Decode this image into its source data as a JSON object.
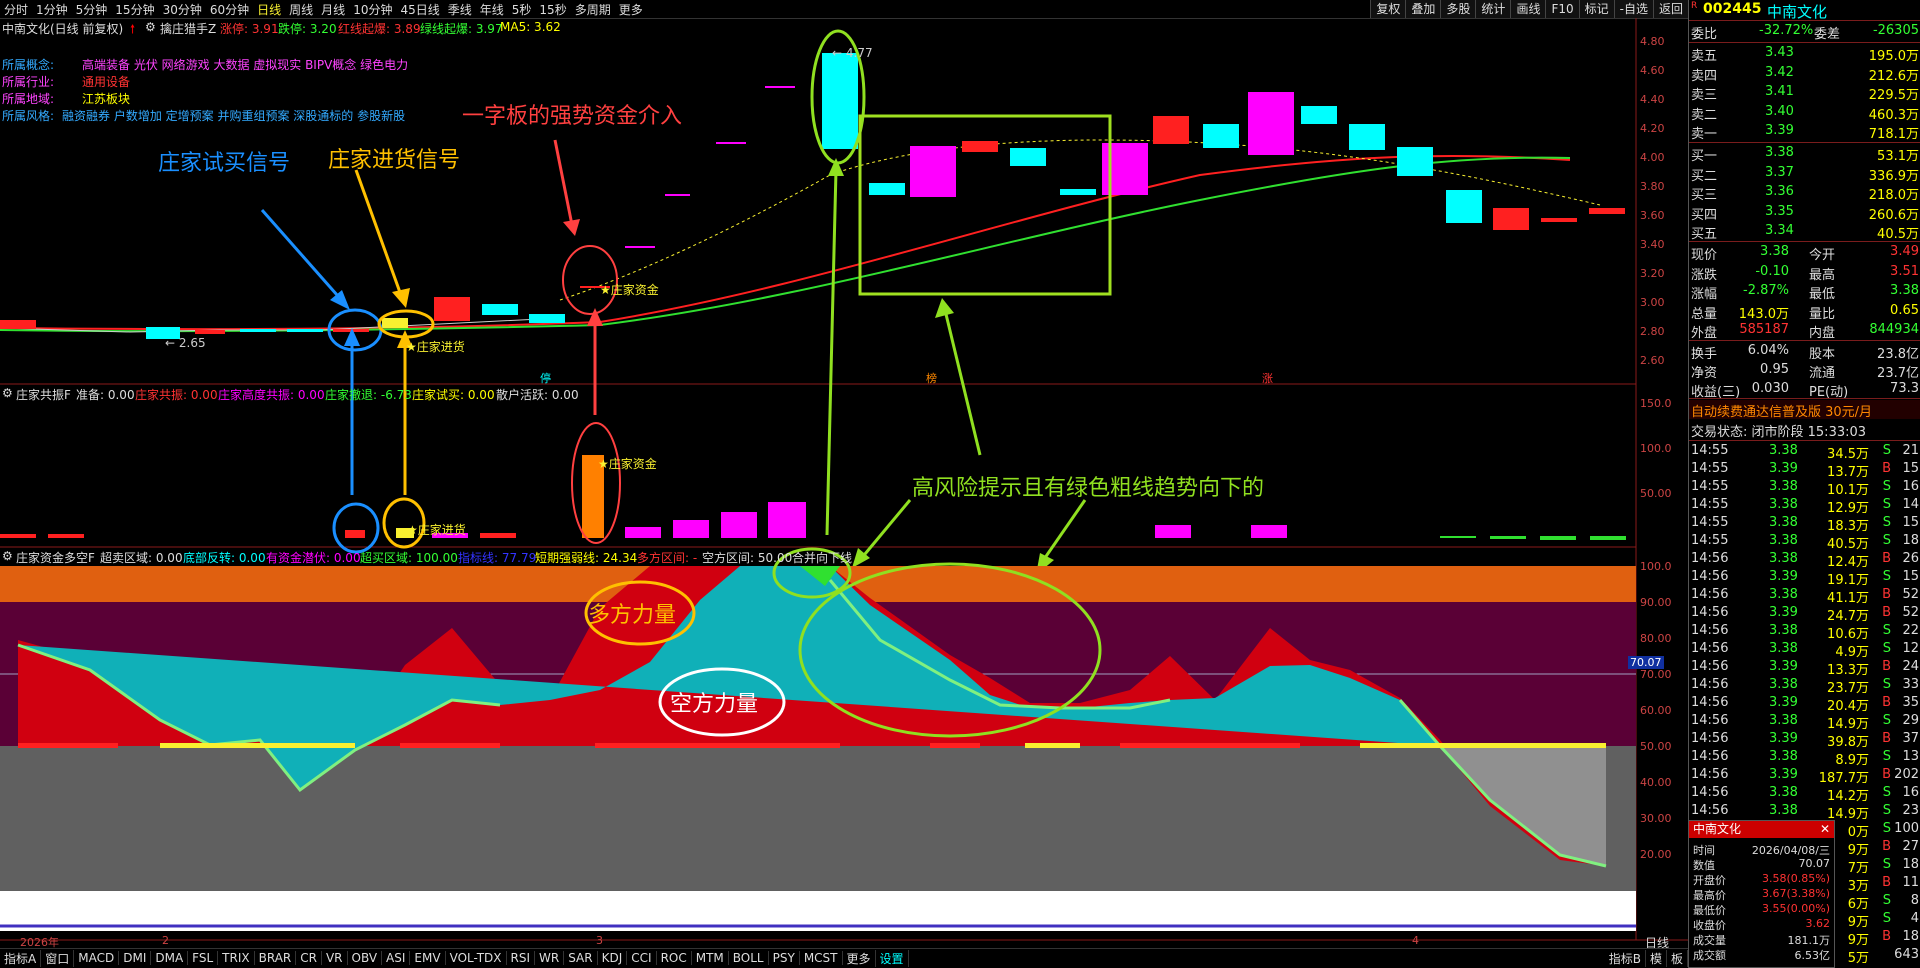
{
  "toolbar": {
    "periods": [
      "分时",
      "1分钟",
      "5分钟",
      "15分钟",
      "30分钟",
      "60分钟",
      "日线",
      "周线",
      "月线",
      "10分钟",
      "45日线",
      "季线",
      "年线",
      "5秒",
      "15秒",
      "多周期",
      "更多"
    ],
    "active": "日线",
    "right_buttons": [
      "复权",
      "叠加",
      "多股",
      "统计",
      "画线",
      "F10",
      "标记",
      "-自选",
      "返回"
    ]
  },
  "main_header": {
    "title": "中南文化(日线 前复权)",
    "indicator": "擒庄猎手Z",
    "items": [
      "涨停: 3.91",
      "跌停: 3.20",
      "红线起爆: 3.89",
      "绿线起爆: 3.97",
      "MA5: 3.62"
    ]
  },
  "concept": {
    "rows": [
      {
        "k": "所属概念:",
        "v": "高端装备 光伏 网络游戏 大数据 虚拟现实 BIPV概念 绿色电力"
      },
      {
        "k": "所属行业:",
        "v": "通用设备"
      },
      {
        "k": "所属地域:",
        "v": "江苏板块"
      },
      {
        "k": "所属风格:",
        "v": "融资融券 户数增加 定增预案 并购重组预案 深股通标的 参股新股"
      }
    ]
  },
  "annotations": {
    "a1": "庄家试买信号",
    "a2": "庄家进货信号",
    "a3": "一字板的强势资金介入",
    "a4": "高风险提示且有绿色粗线趋势向下的",
    "a5": "多方力量",
    "a6": "空方力量"
  },
  "chart_marks": {
    "zj1": "★庄家资金",
    "zj2": "★庄家进货",
    "zj3": "★庄家资金",
    "zj4": "★庄家进货",
    "low": "← 2.65",
    "high": "← 4.77",
    "tag1": "停",
    "tag2": "榜",
    "tag3": "涨"
  },
  "axis_main": [
    "4.80",
    "4.60",
    "4.40",
    "4.20",
    "4.00",
    "3.80",
    "3.60",
    "3.40",
    "3.20",
    "3.00",
    "2.80",
    "2.60"
  ],
  "axis_sub1": [
    "150.0",
    "100.0",
    "50.00"
  ],
  "axis_sub2": [
    "100.0",
    "90.00",
    "80.00",
    "70.00",
    "60.00",
    "50.00",
    "40.00",
    "30.00",
    "20.00"
  ],
  "axis_sub2_hl": "70.07",
  "sub1_header": {
    "title": "庄家共振F",
    "items": [
      "准备: 0.00",
      "庄家共振: 0.00",
      "庄家高度共振: 0.00",
      "庄家撤退: -6.73",
      "庄家试买: 0.00",
      "散户活跃: 0.00"
    ]
  },
  "sub2_header": {
    "title": "庄家资金多空F",
    "items": [
      "超卖区域: 0.00",
      "底部反转: 0.00",
      "有资金潜伏: 0.00",
      "超买区域: 100.00",
      "指标线: 77.79",
      "短期强弱线: 24.34",
      "多方区间: -",
      "空方区间: 50.00",
      "合并向下线"
    ]
  },
  "date_axis": {
    "labels": [
      "2026年",
      "2",
      "3",
      "4"
    ],
    "right": "日线"
  },
  "bottom_tabs": [
    "指标A",
    "窗口",
    "MACD",
    "DMI",
    "DMA",
    "FSL",
    "TRIX",
    "BRAR",
    "CR",
    "VR",
    "OBV",
    "ASI",
    "EMV",
    "VOL-TDX",
    "RSI",
    "WR",
    "SAR",
    "KDJ",
    "CCI",
    "ROC",
    "MTM",
    "BOLL",
    "PSY",
    "MCST",
    "更多",
    "设置"
  ],
  "bottom_right": [
    "指标B",
    "模",
    "板"
  ],
  "quote": {
    "code": "002445",
    "name": "中南文化",
    "weibi": {
      "k": "委比",
      "v": "-32.72%",
      "k2": "委差",
      "v2": "-26305"
    },
    "asks": [
      {
        "k": "卖五",
        "p": "3.43",
        "v": "195.0万"
      },
      {
        "k": "卖四",
        "p": "3.42",
        "v": "212.6万"
      },
      {
        "k": "卖三",
        "p": "3.41",
        "v": "229.5万"
      },
      {
        "k": "卖二",
        "p": "3.40",
        "v": "460.3万"
      },
      {
        "k": "卖一",
        "p": "3.39",
        "v": "718.1万"
      }
    ],
    "bids": [
      {
        "k": "买一",
        "p": "3.38",
        "v": "53.1万"
      },
      {
        "k": "买二",
        "p": "3.37",
        "v": "336.9万"
      },
      {
        "k": "买三",
        "p": "3.36",
        "v": "218.0万"
      },
      {
        "k": "买四",
        "p": "3.35",
        "v": "260.6万"
      },
      {
        "k": "买五",
        "p": "3.34",
        "v": "40.5万"
      }
    ],
    "stats": [
      {
        "k": "现价",
        "v": "3.38",
        "k2": "今开",
        "v2": "3.49"
      },
      {
        "k": "涨跌",
        "v": "-0.10",
        "k2": "最高",
        "v2": "3.51"
      },
      {
        "k": "涨幅",
        "v": "-2.87%",
        "k2": "最低",
        "v2": "3.38"
      },
      {
        "k": "总量",
        "v": "143.0万",
        "k2": "量比",
        "v2": "0.65"
      },
      {
        "k": "外盘",
        "v": "585187",
        "k2": "内盘",
        "v2": "844934"
      }
    ],
    "stats2": [
      {
        "k": "换手",
        "v": "6.04%",
        "k2": "股本",
        "v2": "23.8亿"
      },
      {
        "k": "净资",
        "v": "0.95",
        "k2": "流通",
        "v2": "23.7亿"
      },
      {
        "k": "收益(三)",
        "v": "0.030",
        "k2": "PE(动)",
        "v2": "73.3"
      }
    ],
    "ad": "自动续费通达信普及版 30元/月",
    "status": "交易状态: 闭市阶段 15:33:03",
    "ticks": [
      {
        "t": "14:55",
        "p": "3.38",
        "v": "34.5万",
        "s": "S",
        "n": "21"
      },
      {
        "t": "14:55",
        "p": "3.39",
        "v": "13.7万",
        "s": "B",
        "n": "15"
      },
      {
        "t": "14:55",
        "p": "3.38",
        "v": "10.1万",
        "s": "S",
        "n": "16"
      },
      {
        "t": "14:55",
        "p": "3.38",
        "v": "12.9万",
        "s": "S",
        "n": "14"
      },
      {
        "t": "14:55",
        "p": "3.38",
        "v": "18.3万",
        "s": "S",
        "n": "15"
      },
      {
        "t": "14:55",
        "p": "3.38",
        "v": "40.5万",
        "s": "S",
        "n": "18"
      },
      {
        "t": "14:56",
        "p": "3.38",
        "v": "12.4万",
        "s": "B",
        "n": "26"
      },
      {
        "t": "14:56",
        "p": "3.39",
        "v": "19.1万",
        "s": "S",
        "n": "15"
      },
      {
        "t": "14:56",
        "p": "3.38",
        "v": "41.1万",
        "s": "B",
        "n": "52"
      },
      {
        "t": "14:56",
        "p": "3.39",
        "v": "24.7万",
        "s": "B",
        "n": "52"
      },
      {
        "t": "14:56",
        "p": "3.38",
        "v": "10.6万",
        "s": "S",
        "n": "22"
      },
      {
        "t": "14:56",
        "p": "3.38",
        "v": "4.9万",
        "s": "S",
        "n": "12"
      },
      {
        "t": "14:56",
        "p": "3.39",
        "v": "13.3万",
        "s": "B",
        "n": "24"
      },
      {
        "t": "14:56",
        "p": "3.38",
        "v": "23.7万",
        "s": "S",
        "n": "33"
      },
      {
        "t": "14:56",
        "p": "3.39",
        "v": "20.4万",
        "s": "B",
        "n": "35"
      },
      {
        "t": "14:56",
        "p": "3.38",
        "v": "14.9万",
        "s": "S",
        "n": "29"
      },
      {
        "t": "14:56",
        "p": "3.39",
        "v": "39.8万",
        "s": "B",
        "n": "37"
      },
      {
        "t": "14:56",
        "p": "3.38",
        "v": "8.9万",
        "s": "S",
        "n": "13"
      },
      {
        "t": "14:56",
        "p": "3.39",
        "v": "187.7万",
        "s": "B",
        "n": "202"
      },
      {
        "t": "14:56",
        "p": "3.38",
        "v": "14.2万",
        "s": "S",
        "n": "16"
      },
      {
        "t": "14:56",
        "p": "3.38",
        "v": "14.9万",
        "s": "S",
        "n": "23"
      },
      {
        "t": "",
        "p": "",
        "v": "0万",
        "s": "S",
        "n": "100"
      },
      {
        "t": "",
        "p": "",
        "v": "9万",
        "s": "B",
        "n": "27"
      },
      {
        "t": "",
        "p": "",
        "v": "7万",
        "s": "S",
        "n": "18"
      },
      {
        "t": "",
        "p": "",
        "v": "3万",
        "s": "B",
        "n": "11"
      },
      {
        "t": "",
        "p": "",
        "v": "6万",
        "s": "S",
        "n": "8"
      },
      {
        "t": "",
        "p": "",
        "v": "9万",
        "s": "S",
        "n": "4"
      },
      {
        "t": "",
        "p": "",
        "v": "9万",
        "s": "B",
        "n": "18"
      },
      {
        "t": "",
        "p": "",
        "v": "5万",
        "s": "",
        "n": "643"
      }
    ]
  },
  "popup": {
    "title": "中南文化",
    "rows": [
      {
        "k": "时间",
        "v": "2026/04/08/三"
      },
      {
        "k": "数值",
        "v": "70.07"
      },
      {
        "k": "开盘价",
        "v": "3.58(0.85%)"
      },
      {
        "k": "最高价",
        "v": "3.67(3.38%)"
      },
      {
        "k": "最低价",
        "v": "3.55(0.00%)"
      },
      {
        "k": "收盘价",
        "v": "3.62"
      },
      {
        "k": "成交量",
        "v": "181.1万"
      },
      {
        "k": "成交额",
        "v": "6.53亿"
      }
    ]
  },
  "colors": {
    "up": "#ff2020",
    "down": "#00ffff",
    "bg": "#000000",
    "axis": "#8a1a1a",
    "yellow": "#f8f030"
  }
}
